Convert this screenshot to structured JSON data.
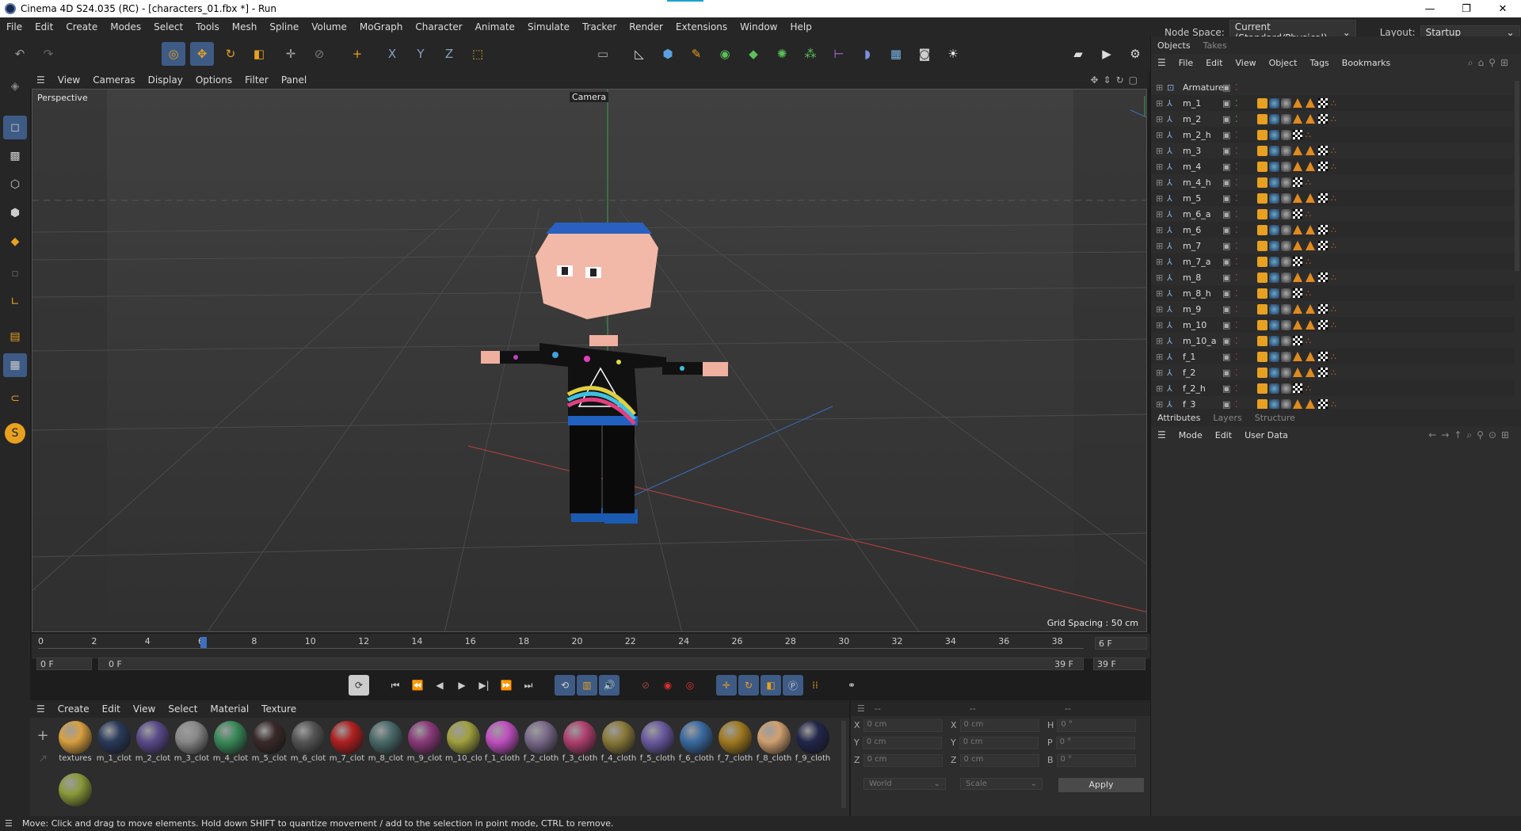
{
  "window": {
    "title": "Cinema 4D S24.035 (RC) - [characters_01.fbx *] - Run",
    "minimize": "—",
    "maximize": "❐",
    "close": "✕"
  },
  "menubar": {
    "items": [
      "File",
      "Edit",
      "Create",
      "Modes",
      "Select",
      "Tools",
      "Mesh",
      "Spline",
      "Volume",
      "MoGraph",
      "Character",
      "Animate",
      "Simulate",
      "Tracker",
      "Render",
      "Extensions",
      "Window",
      "Help"
    ],
    "node_space_label": "Node Space:",
    "node_space_value": "Current (Standard/Physical)",
    "layout_label": "Layout:",
    "layout_value": "Startup"
  },
  "viewport": {
    "menu": [
      "View",
      "Cameras",
      "Display",
      "Options",
      "Filter",
      "Panel"
    ],
    "label": "Perspective",
    "camera_label": "Camera",
    "grid_spacing": "Grid Spacing : 50 cm"
  },
  "timeline": {
    "ticks": [
      "0",
      "2",
      "4",
      "6",
      "8",
      "10",
      "12",
      "14",
      "16",
      "18",
      "20",
      "22",
      "24",
      "26",
      "28",
      "30",
      "32",
      "34",
      "36",
      "38"
    ],
    "current_frame": "6 F",
    "start_frame": "0 F",
    "range_start": "0 F",
    "range_end": "39 F",
    "end_frame": "39 F"
  },
  "materials": {
    "menu": [
      "Create",
      "Edit",
      "View",
      "Select",
      "Material",
      "Texture"
    ],
    "items": [
      {
        "name": "textures",
        "color": "#d8a040"
      },
      {
        "name": "m_1_clot",
        "color": "#2a3a5a"
      },
      {
        "name": "m_2_clot",
        "color": "#5a4a8a"
      },
      {
        "name": "m_3_clot",
        "color": "#888888"
      },
      {
        "name": "m_4_clot",
        "color": "#3a8a5a"
      },
      {
        "name": "m_5_clot",
        "color": "#3a2a2a"
      },
      {
        "name": "m_6_clot",
        "color": "#555555"
      },
      {
        "name": "m_7_clot",
        "color": "#b02020"
      },
      {
        "name": "m_8_clot",
        "color": "#4a6a6a"
      },
      {
        "name": "m_9_clot",
        "color": "#8a3a7a"
      },
      {
        "name": "m_10_clo",
        "color": "#a0a040"
      },
      {
        "name": "f_1_cloth",
        "color": "#c050c0"
      },
      {
        "name": "f_2_cloth",
        "color": "#7a6a8a"
      },
      {
        "name": "f_3_cloth",
        "color": "#b04070"
      },
      {
        "name": "f_4_cloth",
        "color": "#8a7a3a"
      },
      {
        "name": "f_5_cloth",
        "color": "#6a5aa0"
      },
      {
        "name": "f_6_cloth",
        "color": "#3a6aa0"
      },
      {
        "name": "f_7_cloth",
        "color": "#a07a20"
      },
      {
        "name": "f_8_cloth",
        "color": "#d0a070"
      },
      {
        "name": "f_9_cloth",
        "color": "#22264a"
      },
      {
        "name": "",
        "color": "#8a9a3a"
      }
    ]
  },
  "coords": {
    "header": [
      "--",
      "--",
      "--"
    ],
    "rows": [
      {
        "a": "X",
        "av": "0 cm",
        "b": "X",
        "bv": "0 cm",
        "c": "H",
        "cv": "0 °"
      },
      {
        "a": "Y",
        "av": "0 cm",
        "b": "Y",
        "bv": "0 cm",
        "c": "P",
        "cv": "0 °"
      },
      {
        "a": "Z",
        "av": "0 cm",
        "b": "Z",
        "bv": "0 cm",
        "c": "B",
        "cv": "0 °"
      }
    ],
    "world": "World",
    "scale": "Scale",
    "apply": "Apply"
  },
  "objects_panel": {
    "tabs": [
      "Objects",
      "Takes"
    ],
    "menu": [
      "File",
      "Edit",
      "View",
      "Object",
      "Tags",
      "Bookmarks"
    ],
    "rows": [
      {
        "name": "Armature",
        "tags": "none"
      },
      {
        "name": "m_1",
        "tags": "full"
      },
      {
        "name": "m_2",
        "tags": "full"
      },
      {
        "name": "m_2_h",
        "tags": "short"
      },
      {
        "name": "m_3",
        "tags": "full"
      },
      {
        "name": "m_4",
        "tags": "full"
      },
      {
        "name": "m_4_h",
        "tags": "short"
      },
      {
        "name": "m_5",
        "tags": "full"
      },
      {
        "name": "m_6_a",
        "tags": "short"
      },
      {
        "name": "m_6",
        "tags": "full"
      },
      {
        "name": "m_7",
        "tags": "full"
      },
      {
        "name": "m_7_a",
        "tags": "short"
      },
      {
        "name": "m_8",
        "tags": "full"
      },
      {
        "name": "m_8_h",
        "tags": "short"
      },
      {
        "name": "m_9",
        "tags": "full"
      },
      {
        "name": "m_10",
        "tags": "full"
      },
      {
        "name": "m_10_a",
        "tags": "short"
      },
      {
        "name": "f_1",
        "tags": "full"
      },
      {
        "name": "f_2",
        "tags": "full"
      },
      {
        "name": "f_2_h",
        "tags": "short"
      },
      {
        "name": "f_3",
        "tags": "full"
      }
    ]
  },
  "attributes_panel": {
    "tabs": [
      "Attributes",
      "Layers",
      "Structure"
    ],
    "menu": [
      "Mode",
      "Edit",
      "User Data"
    ]
  },
  "status": "Move: Click and drag to move elements. Hold down SHIFT to quantize movement / add to the selection in point mode, CTRL to remove."
}
